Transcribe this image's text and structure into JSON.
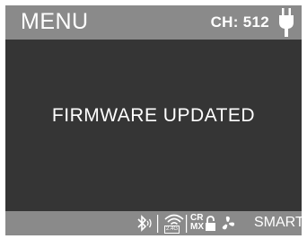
{
  "header": {
    "title": "MENU",
    "channel_label": "CH: 512",
    "power_icon": "plug-icon"
  },
  "message": "FIRMWARE UPDATED",
  "status_bar": {
    "bluetooth_icon": "bluetooth-icon",
    "wireless_icon": "wireless-icon",
    "wireless_band": "2.4G",
    "crmx_line1": "CR",
    "crmx_line2": "MX",
    "lock_icon": "lock-icon",
    "fan_icon": "fan-icon",
    "mode": "SMART"
  },
  "colors": {
    "bar": "#8a8a8a",
    "body": "#353535",
    "text": "#ffffff"
  }
}
